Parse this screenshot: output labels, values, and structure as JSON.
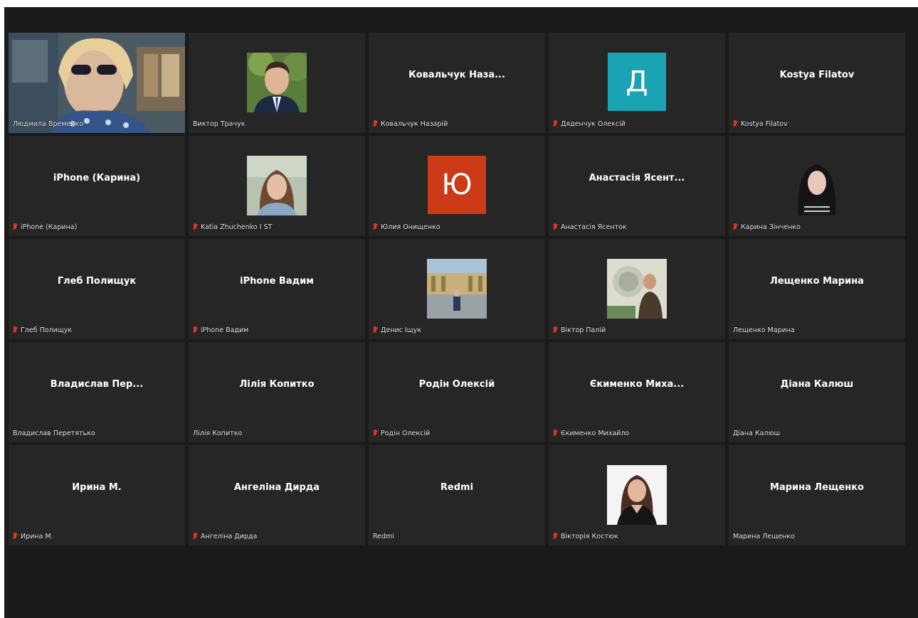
{
  "participants": [
    {
      "display": "",
      "label": "Людмила Временко",
      "muted": false,
      "video": true
    },
    {
      "display": "",
      "label": "Виктор Трачук",
      "muted": false,
      "photo": "man-suit-photo"
    },
    {
      "display": "Ковальчук Наза...",
      "label": "Ковальчук Назарій",
      "muted": true
    },
    {
      "display": "Д",
      "label": "Дяденчук Олексій",
      "muted": true,
      "avatar_color": "#1aa3b3"
    },
    {
      "display": "Kostya Filatov",
      "label": "Kostya Filatov",
      "muted": true
    },
    {
      "display": "iPhone (Карина)",
      "label": "iPhone (Карина)",
      "muted": true
    },
    {
      "display": "",
      "label": "Katia Zhuchenko I ST",
      "muted": true,
      "photo": "woman-photo"
    },
    {
      "display": "Ю",
      "label": "Юлия Онищенко",
      "muted": true,
      "avatar_color": "#cc3a17"
    },
    {
      "display": "Анастасія Ясент...",
      "label": "Анастасія Ясенток",
      "muted": true
    },
    {
      "display": "",
      "label": "Карина Зінченко",
      "muted": true,
      "photo": "woman-dark-photo"
    },
    {
      "display": "Глеб Полищук",
      "label": "Глеб Полищук",
      "muted": true
    },
    {
      "display": "iPhone Вадим",
      "label": "iPhone Вадим",
      "muted": true
    },
    {
      "display": "",
      "label": "Денис Іщук",
      "muted": true,
      "photo": "building-photo"
    },
    {
      "display": "",
      "label": "Віктор Палій",
      "muted": true,
      "photo": "man-photo"
    },
    {
      "display": "Лещенко Марина",
      "label": "Лещенко Марина",
      "muted": false
    },
    {
      "display": "Владислав Пер...",
      "label": "Владислав Перетятько",
      "muted": false
    },
    {
      "display": "Лілія Копитко",
      "label": "Лілія Копитко",
      "muted": false
    },
    {
      "display": "Родін Олексій",
      "label": "Родін Олексій",
      "muted": true
    },
    {
      "display": "Єкименко Миха...",
      "label": "Єкименко Михайло",
      "muted": true
    },
    {
      "display": "Діана Калюш",
      "label": "Діана Калюш",
      "muted": false
    },
    {
      "display": "Ирина М.",
      "label": "Ирина М.",
      "muted": true
    },
    {
      "display": "Ангеліна Дирда",
      "label": "Ангеліна Дирда",
      "muted": true
    },
    {
      "display": "Redmi",
      "label": "Redmi",
      "muted": false
    },
    {
      "display": "",
      "label": "Вікторія Костюк",
      "muted": true,
      "photo": "woman-white-photo"
    },
    {
      "display": "Марина Лещенко",
      "label": "Марина Лещенко",
      "muted": false
    }
  ]
}
